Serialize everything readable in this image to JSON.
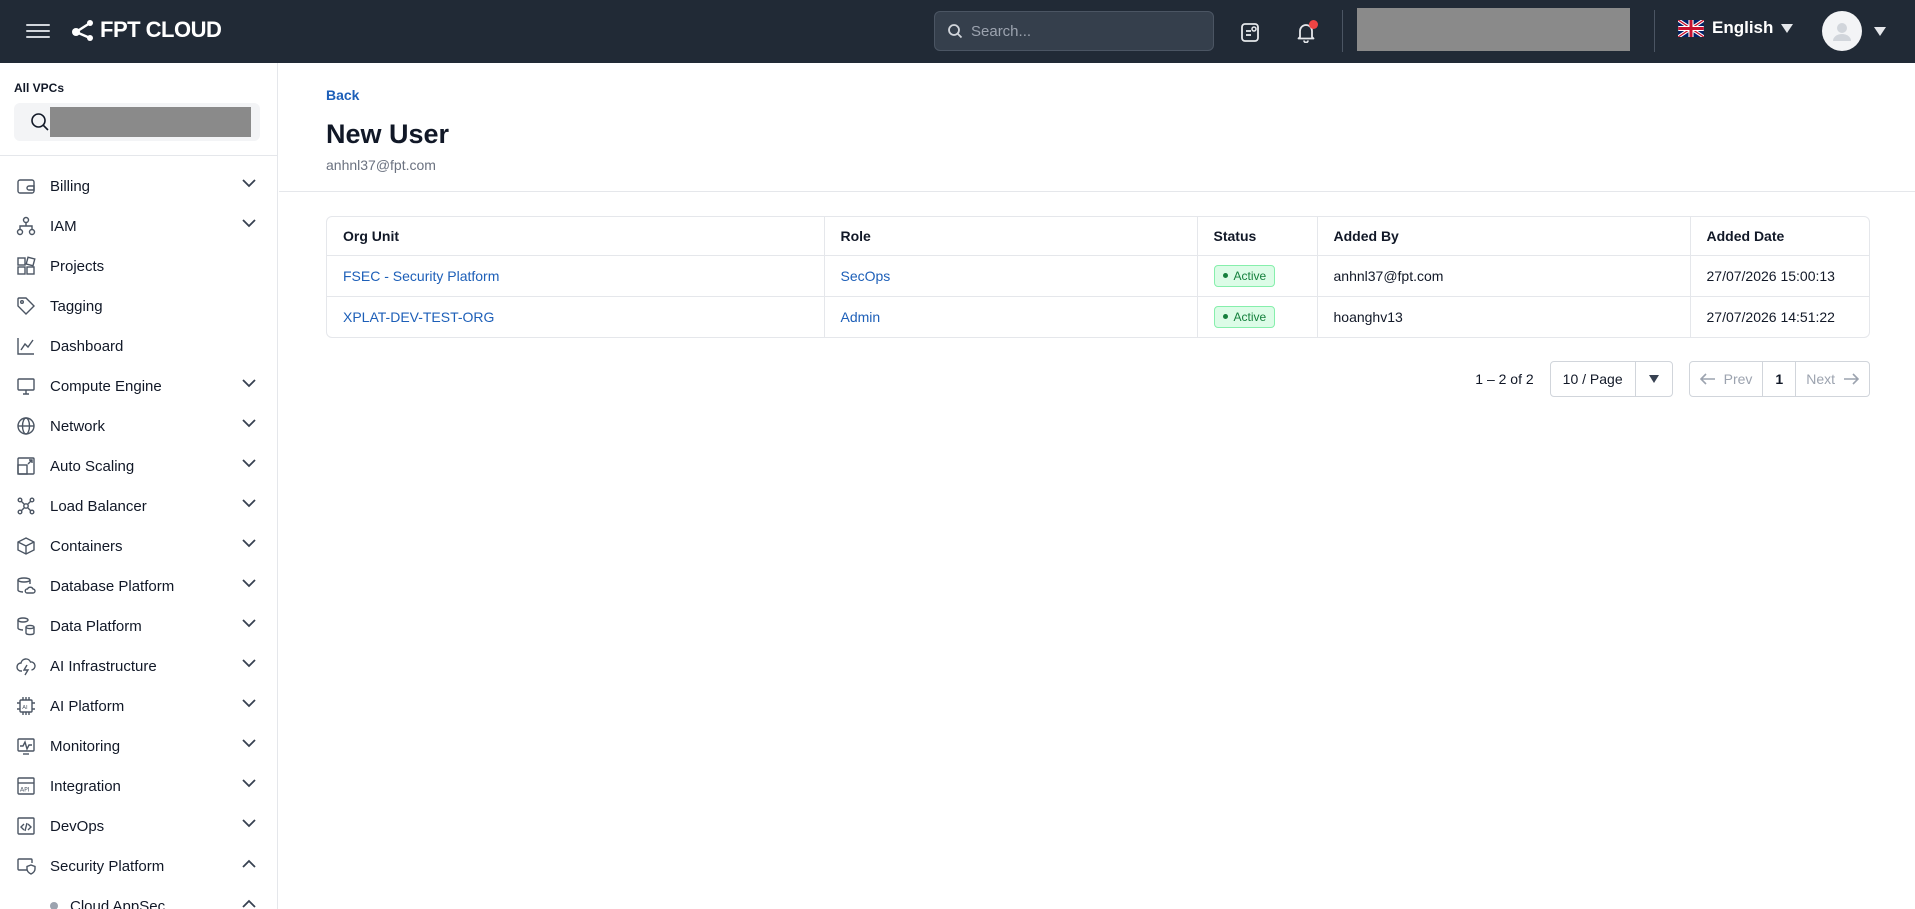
{
  "header": {
    "brand": "FPT CLOUD",
    "search_placeholder": "Search...",
    "language": "English"
  },
  "sidebar": {
    "vpc_label": "All VPCs",
    "items": [
      {
        "label": "Billing",
        "icon": "wallet-icon",
        "expandable": true
      },
      {
        "label": "IAM",
        "icon": "hierarchy-icon",
        "expandable": true
      },
      {
        "label": "Projects",
        "icon": "blocks-icon",
        "expandable": false
      },
      {
        "label": "Tagging",
        "icon": "tag-icon",
        "expandable": false
      },
      {
        "label": "Dashboard",
        "icon": "line-chart-icon",
        "expandable": false
      },
      {
        "label": "Compute Engine",
        "icon": "monitor-icon",
        "expandable": true
      },
      {
        "label": "Network",
        "icon": "globe-icon",
        "expandable": true
      },
      {
        "label": "Auto Scaling",
        "icon": "scaling-icon",
        "expandable": true
      },
      {
        "label": "Load Balancer",
        "icon": "network-nodes-icon",
        "expandable": true
      },
      {
        "label": "Containers",
        "icon": "box-icon",
        "expandable": true
      },
      {
        "label": "Database Platform",
        "icon": "database-cloud-icon",
        "expandable": true
      },
      {
        "label": "Data Platform",
        "icon": "data-stack-icon",
        "expandable": true
      },
      {
        "label": "AI Infrastructure",
        "icon": "cloud-bolt-icon",
        "expandable": true
      },
      {
        "label": "AI Platform",
        "icon": "ai-chip-icon",
        "expandable": true
      },
      {
        "label": "Monitoring",
        "icon": "activity-icon",
        "expandable": true
      },
      {
        "label": "Integration",
        "icon": "api-icon",
        "expandable": true
      },
      {
        "label": "DevOps",
        "icon": "code-file-icon",
        "expandable": true
      },
      {
        "label": "Security Platform",
        "icon": "shield-monitor-icon",
        "expandable": true,
        "expanded": true
      }
    ],
    "sub_item": "Cloud AppSec"
  },
  "main": {
    "back_label": "Back",
    "title": "New User",
    "subtitle": "anhnl37@fpt.com",
    "table": {
      "columns": [
        "Org Unit",
        "Role",
        "Status",
        "Added By",
        "Added Date"
      ],
      "rows": [
        {
          "org_unit": "FSEC - Security Platform",
          "role": "SecOps",
          "status": "Active",
          "added_by": "anhnl37@fpt.com",
          "added_date": "27/07/2026 15:00:13"
        },
        {
          "org_unit": "XPLAT-DEV-TEST-ORG",
          "role": "Admin",
          "status": "Active",
          "added_by": "hoanghv13",
          "added_date": "27/07/2026 14:51:22"
        }
      ]
    },
    "pagination": {
      "range": "1 – 2 of 2",
      "per_page": "10 / Page",
      "prev": "Prev",
      "current": "1",
      "next": "Next"
    }
  },
  "colors": {
    "topbar": "#212a36",
    "link": "#1d5fb8",
    "status_bg": "#dcfce7",
    "status_text": "#15803d"
  }
}
